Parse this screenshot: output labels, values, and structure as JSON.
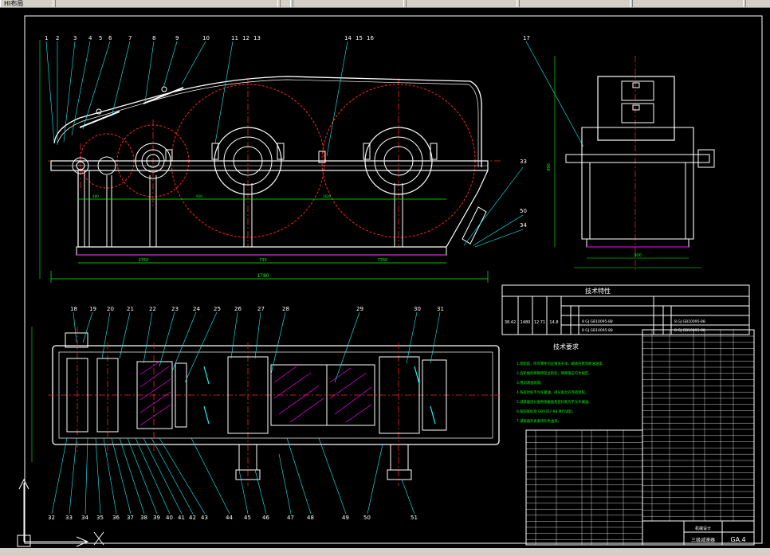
{
  "topbar": {
    "layer_label": "HI布局",
    "fields": [
      "",
      "",
      "",
      "",
      "",
      "",
      ""
    ]
  },
  "labels_top": [
    "1",
    "2",
    "3",
    "4",
    "5",
    "6",
    "7",
    "8",
    "9",
    "10",
    "11",
    "12",
    "13",
    "14",
    "15",
    "16",
    "17"
  ],
  "labels_right": [
    "33",
    "50",
    "34"
  ],
  "labels_mid": [
    "18",
    "19",
    "20",
    "21",
    "22",
    "23",
    "24",
    "25",
    "26",
    "27",
    "28",
    "29",
    "30",
    "31"
  ],
  "labels_bottom": [
    "32",
    "33",
    "34",
    "35",
    "36",
    "37",
    "38",
    "39",
    "40",
    "41",
    "42",
    "43",
    "44",
    "45",
    "46",
    "47",
    "48",
    "49",
    "50",
    "51"
  ],
  "tech_char": {
    "title": "技术特性",
    "power": "38.42",
    "speed": "1480",
    "ratio": "12.71",
    "eff": "14.8"
  },
  "tech_req": {
    "title": "技术要求",
    "lines": [
      "1.装配前，所有零件均应清洗干净，箱体内壁涂耐油油漆。",
      "2.齿轮副的侧隙用铅丝检验，侧隙值应符合规定。",
      "3.用润滑油润滑。",
      "4.各密封处不允许漏油，剖分面允许涂密封胶。",
      "5.减速器剖分面各接触面及密封处均不允许漏油。",
      "6.按国家标准 GB9357-88 进行试验。",
      "7.减速器外表面涂灰色油漆。"
    ]
  },
  "gear_codes": [
    "8 GJ GB10095-88",
    "8 GJ GB10095-88",
    "8 GJ GB10095-88",
    "8 GJ GB10095-88"
  ],
  "title_block": {
    "name": "三级减速器",
    "drawing_no": "GA.4",
    "school": "机械设计"
  },
  "dims": {
    "total_length": "1780",
    "height": "990",
    "width": "900",
    "span1": "2350",
    "span2": "735",
    "span3": "7350",
    "center1": "480",
    "center2": "910",
    "center3": "1620"
  },
  "colors": {
    "outline": "#ffffff",
    "centerline": "#ff2020",
    "hatch": "#ff00ff",
    "leader": "#00ffff",
    "dimension": "#00ff00",
    "part": "#e0e0e0"
  }
}
